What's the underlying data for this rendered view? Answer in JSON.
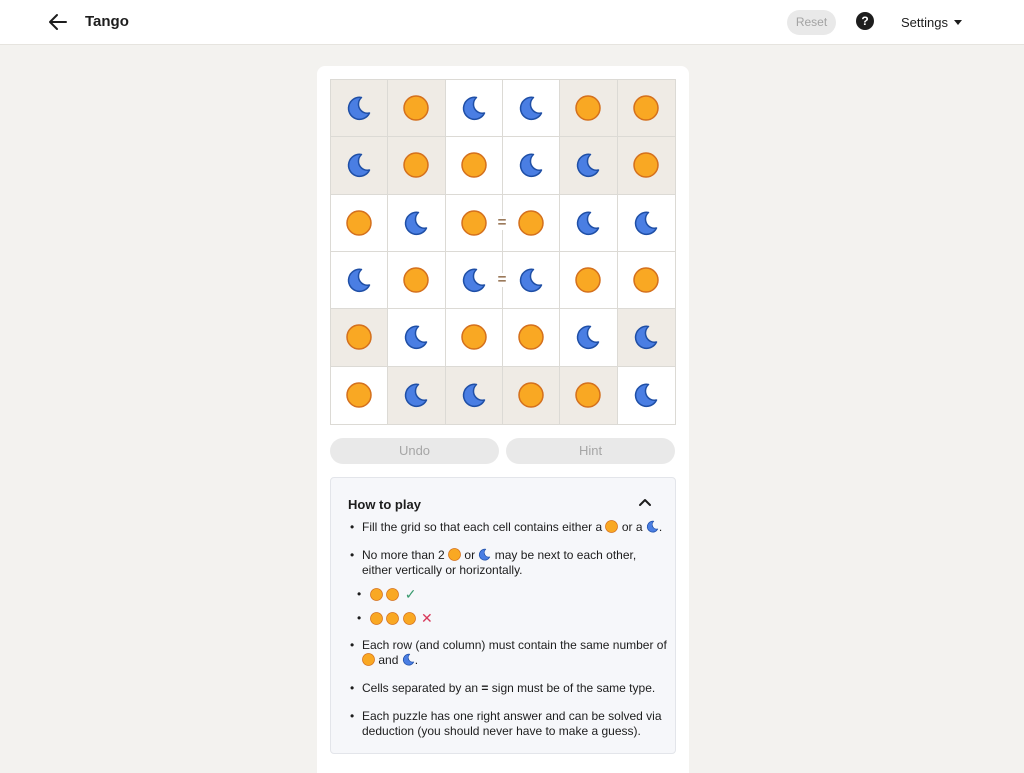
{
  "header": {
    "title": "Tango",
    "reset_label": "Reset",
    "help_label": "?",
    "settings_label": "Settings"
  },
  "board": {
    "size": 6,
    "cells": [
      [
        "moon",
        "sun",
        "moon",
        "moon",
        "sun",
        "sun"
      ],
      [
        "moon",
        "sun",
        "sun",
        "moon",
        "moon",
        "sun"
      ],
      [
        "sun",
        "moon",
        "sun",
        "sun",
        "moon",
        "moon"
      ],
      [
        "moon",
        "sun",
        "moon",
        "moon",
        "sun",
        "sun"
      ],
      [
        "sun",
        "moon",
        "sun",
        "sun",
        "moon",
        "moon"
      ],
      [
        "sun",
        "moon",
        "moon",
        "sun",
        "sun",
        "moon"
      ]
    ],
    "locked": [
      [
        true,
        true,
        false,
        false,
        true,
        true
      ],
      [
        true,
        true,
        false,
        false,
        true,
        true
      ],
      [
        false,
        false,
        false,
        false,
        false,
        false
      ],
      [
        false,
        false,
        false,
        false,
        false,
        false
      ],
      [
        true,
        false,
        false,
        false,
        false,
        true
      ],
      [
        false,
        true,
        true,
        true,
        true,
        false
      ]
    ],
    "constraints": [
      {
        "row": 2,
        "col": 2,
        "dir": "right",
        "symbol": "="
      },
      {
        "row": 3,
        "col": 2,
        "dir": "right",
        "symbol": "="
      }
    ]
  },
  "controls": {
    "undo_label": "Undo",
    "hint_label": "Hint"
  },
  "how_to_play": {
    "title": "How to play",
    "rule1_a": "Fill the grid so that each cell contains either a",
    "rule1_b": "or a",
    "rule1_c": ".",
    "rule2_a": "No more than 2",
    "rule2_b": "or",
    "rule2_c": "may be next to each other, either vertically or horizontally.",
    "check_mark": "✓",
    "cross_mark": "✕",
    "rule3_a": "Each row (and column) must contain the same number of",
    "rule3_b": "and",
    "rule3_c": ".",
    "rule4_a": "Cells separated by an",
    "rule4_eq": "=",
    "rule4_b": "sign must be of the same type.",
    "rule5": "Each puzzle has one right answer and can be solved via deduction (you should never have to make a guess)."
  },
  "colors": {
    "sun_fill": "#f9a823",
    "sun_stroke": "#d4701d",
    "moon_fill": "#4a7ee3",
    "moon_stroke": "#1f4fa6",
    "locked_cell": "#efebe5",
    "equal_sign": "#9b7a5b"
  }
}
